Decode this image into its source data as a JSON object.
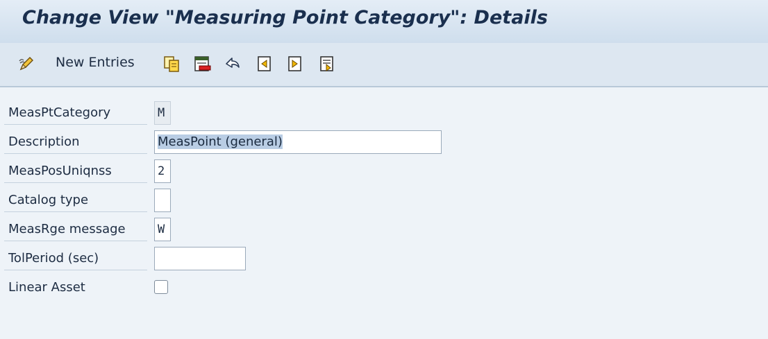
{
  "window": {
    "title": "Change View \"Measuring Point Category\": Details"
  },
  "toolbar": {
    "edit_icon": "edit-pencil-icon",
    "new_entries_label": "New Entries",
    "icons": [
      "copy-as-icon",
      "delete-icon",
      "undo-icon",
      "previous-entry-icon",
      "next-entry-icon",
      "select-entry-icon"
    ]
  },
  "form": {
    "fields": [
      {
        "label": "MeasPtCategory",
        "value": "M",
        "readonly": true
      },
      {
        "label": "Description",
        "value": "MeasPoint (general)",
        "selected": true
      },
      {
        "label": "MeasPosUniqnss",
        "value": "2"
      },
      {
        "label": "Catalog type",
        "value": ""
      },
      {
        "label": "MeasRge message",
        "value": "W"
      },
      {
        "label": "TolPeriod (sec)",
        "value": ""
      },
      {
        "label": "Linear Asset",
        "checked": false
      }
    ]
  }
}
